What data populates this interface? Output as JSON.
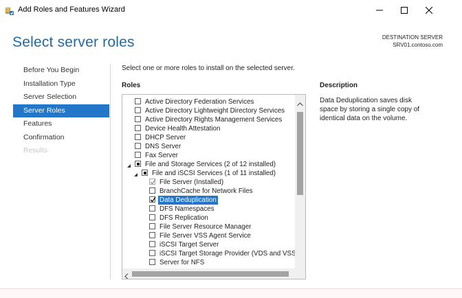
{
  "window": {
    "title": "Add Roles and Features Wizard"
  },
  "page": {
    "title": "Select server roles",
    "destination_label": "DESTINATION SERVER",
    "destination_server": "SRV01.contoso.com",
    "instructions": "Select one or more roles to install on the selected server.",
    "roles_label": "Roles",
    "description_label": "Description",
    "description_text": "Data Deduplication saves disk space by storing a single copy of identical data on the volume."
  },
  "nav": [
    {
      "label": "Before You Begin",
      "state": "normal"
    },
    {
      "label": "Installation Type",
      "state": "normal"
    },
    {
      "label": "Server Selection",
      "state": "normal"
    },
    {
      "label": "Server Roles",
      "state": "active"
    },
    {
      "label": "Features",
      "state": "normal"
    },
    {
      "label": "Confirmation",
      "state": "normal"
    },
    {
      "label": "Results",
      "state": "disabled"
    }
  ],
  "roles": [
    {
      "label": "Active Directory Federation Services",
      "level": 0,
      "check": "none",
      "expander": "none"
    },
    {
      "label": "Active Directory Lightweight Directory Services",
      "level": 0,
      "check": "none",
      "expander": "none"
    },
    {
      "label": "Active Directory Rights Management Services",
      "level": 0,
      "check": "none",
      "expander": "none"
    },
    {
      "label": "Device Health Attestation",
      "level": 0,
      "check": "none",
      "expander": "none"
    },
    {
      "label": "DHCP Server",
      "level": 0,
      "check": "none",
      "expander": "none"
    },
    {
      "label": "DNS Server",
      "level": 0,
      "check": "none",
      "expander": "none"
    },
    {
      "label": "Fax Server",
      "level": 0,
      "check": "none",
      "expander": "none"
    },
    {
      "label": "File and Storage Services (2 of 12 installed)",
      "level": 0,
      "check": "partial",
      "expander": "expanded"
    },
    {
      "label": "File and iSCSI Services (1 of 11 installed)",
      "level": 1,
      "check": "partial",
      "expander": "expanded"
    },
    {
      "label": "File Server (Installed)",
      "level": 2,
      "check": "checked-disabled",
      "expander": "none"
    },
    {
      "label": "BranchCache for Network Files",
      "level": 2,
      "check": "none",
      "expander": "none"
    },
    {
      "label": "Data Deduplication",
      "level": 2,
      "check": "checked",
      "expander": "none",
      "selected": true
    },
    {
      "label": "DFS Namespaces",
      "level": 2,
      "check": "none",
      "expander": "none"
    },
    {
      "label": "DFS Replication",
      "level": 2,
      "check": "none",
      "expander": "none"
    },
    {
      "label": "File Server Resource Manager",
      "level": 2,
      "check": "none",
      "expander": "none"
    },
    {
      "label": "File Server VSS Agent Service",
      "level": 2,
      "check": "none",
      "expander": "none"
    },
    {
      "label": "iSCSI Target Server",
      "level": 2,
      "check": "none",
      "expander": "none"
    },
    {
      "label": "iSCSI Target Storage Provider (VDS and VSS",
      "level": 2,
      "check": "none",
      "expander": "none"
    },
    {
      "label": "Server for NFS",
      "level": 2,
      "check": "none",
      "expander": "none"
    }
  ],
  "colors": {
    "accent": "#2376c8",
    "title": "#1f6aa5"
  },
  "icons": {
    "app": "server-manager-icon",
    "minimize": "minimize-icon",
    "maximize": "maximize-icon",
    "close": "close-icon"
  }
}
